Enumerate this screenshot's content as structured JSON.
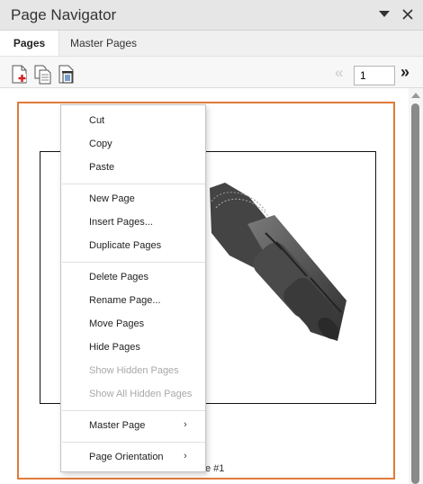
{
  "title": "Page Navigator",
  "tabs": [
    "Pages",
    "Master Pages"
  ],
  "toolbar": {
    "current_page": "1",
    "icons": [
      "new-page-icon",
      "copy-page-icon",
      "delete-page-icon"
    ]
  },
  "page_thumbnail": {
    "label": "e #1",
    "accent_color": "#e07a3a"
  },
  "context_menu": {
    "items": [
      {
        "label": "Cut",
        "enabled": true
      },
      {
        "label": "Copy",
        "enabled": true
      },
      {
        "label": "Paste",
        "enabled": true
      },
      {
        "label": "New Page",
        "enabled": true
      },
      {
        "label": "Insert Pages...",
        "enabled": true
      },
      {
        "label": "Duplicate Pages",
        "enabled": true
      },
      {
        "label": "Delete Pages",
        "enabled": true
      },
      {
        "label": "Rename Page...",
        "enabled": true
      },
      {
        "label": "Move Pages",
        "enabled": true
      },
      {
        "label": "Hide Pages",
        "enabled": true
      },
      {
        "label": "Show Hidden Pages",
        "enabled": false
      },
      {
        "label": "Show All Hidden Pages",
        "enabled": false
      },
      {
        "label": "Master Page",
        "enabled": true,
        "submenu": true
      },
      {
        "label": "Page Orientation",
        "enabled": true,
        "submenu": true
      }
    ]
  }
}
